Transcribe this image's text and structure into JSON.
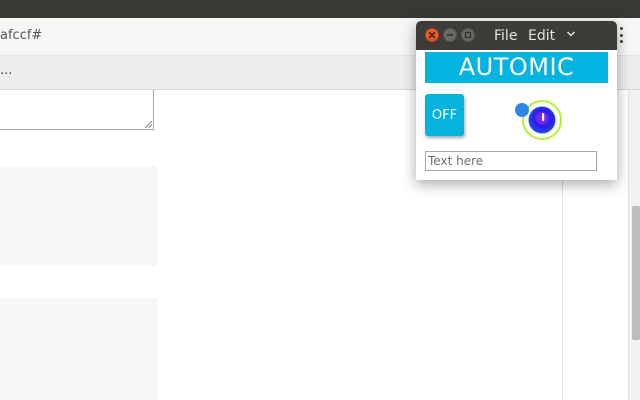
{
  "browser": {
    "url_fragment": "afccf#",
    "toolbar_ellipsis": "..."
  },
  "app_window": {
    "menu": {
      "file": "File",
      "edit": "Edit"
    },
    "banner_text": "AUTOMIC",
    "toggle_label": "OFF",
    "input": {
      "value": "",
      "placeholder": "Text here"
    },
    "colors": {
      "accent": "#03b3e0",
      "titlebar": "#3e3c38",
      "close_button": "#e25b2a",
      "knob_ring": "#b4f23c",
      "knob_core": "#2a1ae6"
    }
  },
  "icons": [
    "close-icon",
    "minimize-icon",
    "maximize-icon",
    "chevron-down-icon",
    "kebab-menu-icon",
    "resize-grip-icon",
    "dial-knob"
  ]
}
